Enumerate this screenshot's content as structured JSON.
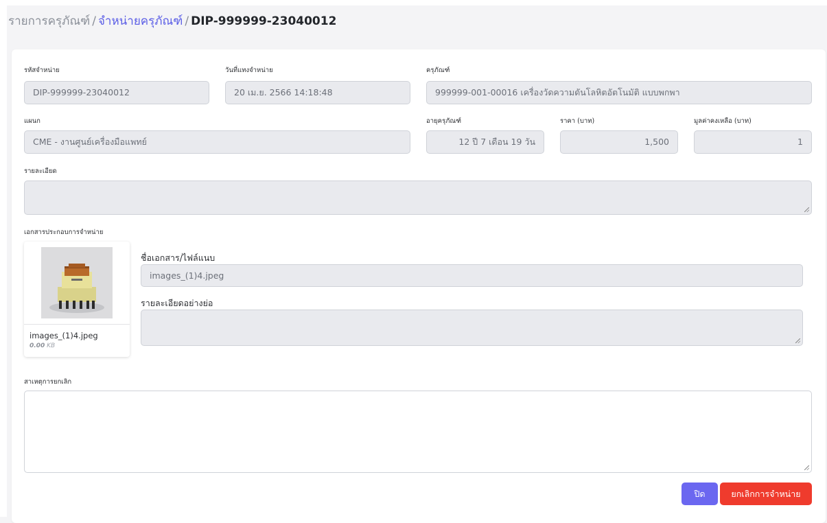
{
  "breadcrumb": {
    "root": "รายการครุภัณฑ์",
    "separator": "/",
    "parent": "จำหน่ายครุภัณฑ์",
    "current": "DIP-999999-23040012"
  },
  "form": {
    "disposal_code": {
      "label": "รหัสจำหน่าย",
      "value": "DIP-999999-23040012"
    },
    "disposal_date": {
      "label": "วันที่แทงจำหน่าย",
      "value": "20 เม.ย. 2566 14:18:48"
    },
    "asset": {
      "label": "ครุภัณฑ์",
      "value": "999999-001-00016 เครื่องวัดความดันโลหิตอัตโนมัติ แบบพกพา"
    },
    "department": {
      "label": "แผนก",
      "value": "CME - งานศูนย์เครื่องมือแพทย์"
    },
    "asset_age": {
      "label": "อายุครุภัณฑ์",
      "value": "12 ปี 7 เดือน 19 วัน"
    },
    "price": {
      "label": "ราคา (บาท)",
      "value": "1,500"
    },
    "residual_value": {
      "label": "มูลค่าคงเหลือ (บาท)",
      "value": "1"
    },
    "details": {
      "label": "รายละเอียด",
      "value": ""
    },
    "documents_label": "เอกสารประกอบการจำหน่าย",
    "cancel_reason": {
      "label": "สาเหตุการยกเลิก",
      "value": ""
    }
  },
  "attachment": {
    "file_name": "images_(1)4.jpeg",
    "size_value": "0.00",
    "size_unit": "KB",
    "doc_name_label": "ชื่อเอกสาร/ไฟล์แนบ",
    "doc_name_value": "images_(1)4.jpeg",
    "summary_label": "รายละเอียดอย่างย่อ",
    "summary_value": ""
  },
  "buttons": {
    "close": "ปิด",
    "cancel_disposal": "ยกเลิกการจำหน่าย"
  },
  "colors": {
    "primary": "#6b67f0",
    "danger": "#ef3b2d",
    "link": "#5b5ee6"
  }
}
